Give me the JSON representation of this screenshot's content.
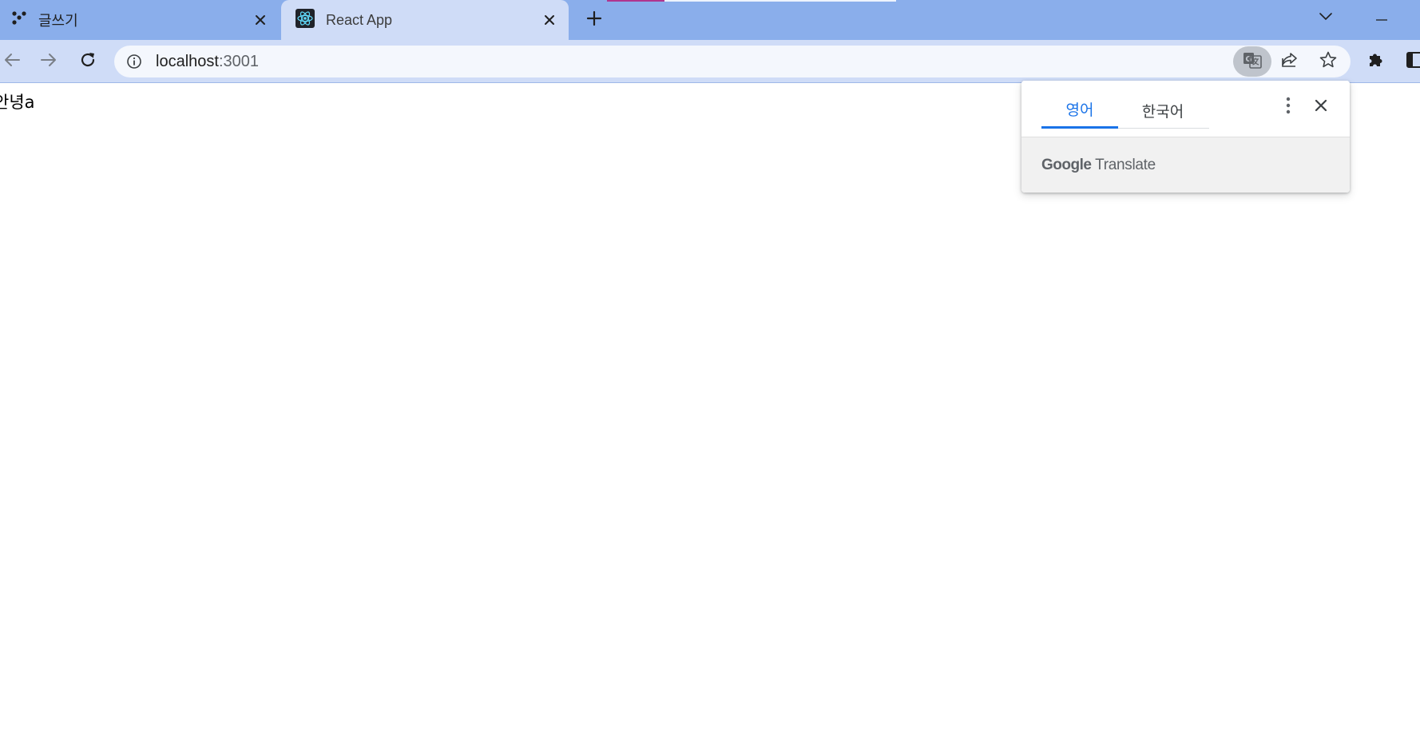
{
  "tabs": [
    {
      "title": "글쓰기",
      "icon": "brand-dots-icon",
      "active": false
    },
    {
      "title": "React App",
      "icon": "react-logo-icon",
      "active": true
    }
  ],
  "toolbar": {
    "url_host": "localhost",
    "url_port": ":3001"
  },
  "page": {
    "body_text": "안녕a"
  },
  "translate_popup": {
    "source_language": "영어",
    "target_language": "한국어",
    "brand_google": "Google",
    "brand_translate": "Translate"
  },
  "colors": {
    "tabstrip": "#8aaeeb",
    "toolbar": "#cfdcf7",
    "accent": "#1a73e8"
  }
}
